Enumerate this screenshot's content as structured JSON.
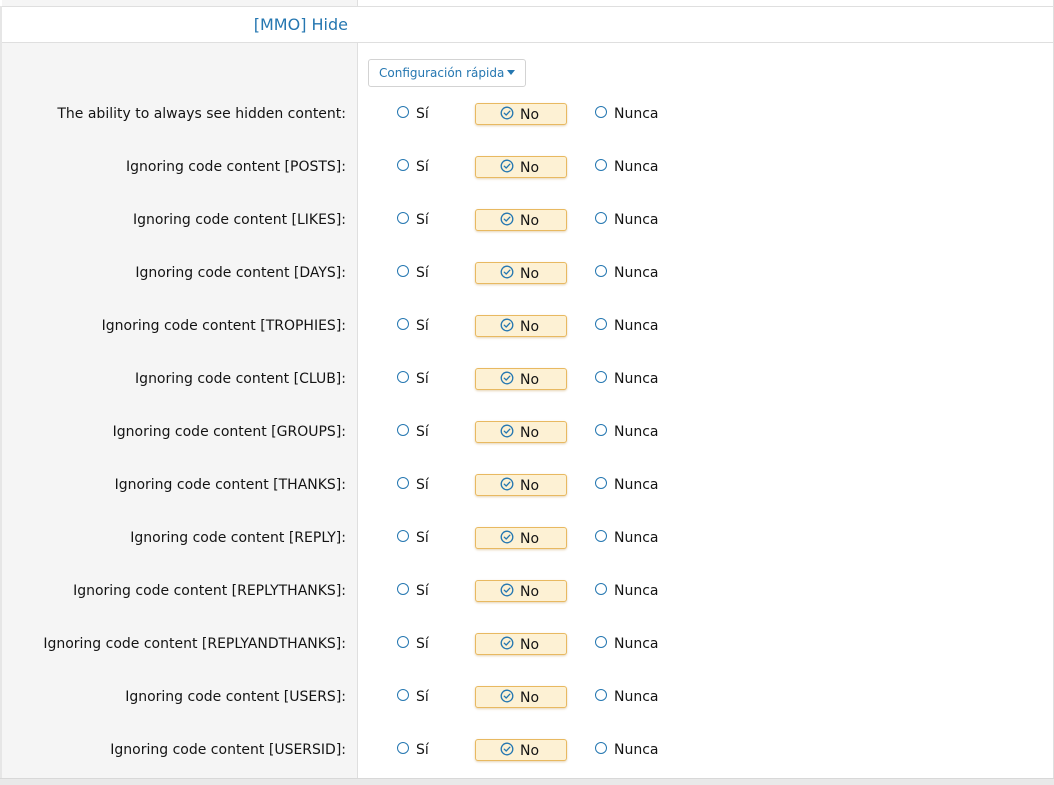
{
  "section": {
    "title": "[MMO] Hide"
  },
  "quick_config": {
    "label": "Configuración rápida"
  },
  "option_labels": {
    "yes": "Sí",
    "no": "No",
    "never": "Nunca"
  },
  "rows": [
    {
      "label": "The ability to always see hidden content:",
      "selected": "no"
    },
    {
      "label": "Ignoring code content [POSTS]:",
      "selected": "no"
    },
    {
      "label": "Ignoring code content [LIKES]:",
      "selected": "no"
    },
    {
      "label": "Ignoring code content [DAYS]:",
      "selected": "no"
    },
    {
      "label": "Ignoring code content [TROPHIES]:",
      "selected": "no"
    },
    {
      "label": "Ignoring code content [CLUB]:",
      "selected": "no"
    },
    {
      "label": "Ignoring code content [GROUPS]:",
      "selected": "no"
    },
    {
      "label": "Ignoring code content [THANKS]:",
      "selected": "no"
    },
    {
      "label": "Ignoring code content [REPLY]:",
      "selected": "no"
    },
    {
      "label": "Ignoring code content [REPLYTHANKS]:",
      "selected": "no"
    },
    {
      "label": "Ignoring code content [REPLYANDTHANKS]:",
      "selected": "no"
    },
    {
      "label": "Ignoring code content [USERS]:",
      "selected": "no"
    },
    {
      "label": "Ignoring code content [USERSID]:",
      "selected": "no"
    }
  ],
  "colors": {
    "accent": "#2577b1",
    "selected_bg": "#fdf1d4",
    "selected_border": "#e8b961",
    "label_column_bg": "#f5f5f5"
  },
  "icons": {
    "radio": "radio-circle-icon",
    "selected": "check-circle-icon",
    "dropdown": "caret-down-icon"
  }
}
